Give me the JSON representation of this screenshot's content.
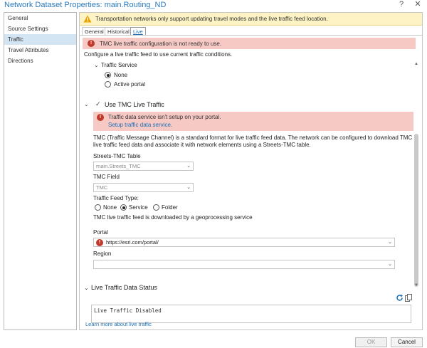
{
  "window": {
    "title": "Network Dataset Properties: main.Routing_ND",
    "help_glyph": "?",
    "close_glyph": "✕"
  },
  "sidebar": {
    "items": [
      {
        "label": "General"
      },
      {
        "label": "Source Settings"
      },
      {
        "label": "Traffic"
      },
      {
        "label": "Travel Attributes"
      },
      {
        "label": "Directions"
      }
    ]
  },
  "warning": {
    "text": "Transportation networks only support updating travel modes and the live traffic feed location."
  },
  "tabs": [
    {
      "label": "General"
    },
    {
      "label": "Historical"
    },
    {
      "label": "Live"
    }
  ],
  "error_banner": {
    "text": "TMC live traffic configuration is not ready to use."
  },
  "live": {
    "intro": "Configure a live traffic feed to use current traffic conditions.",
    "traffic_service": {
      "label": "Traffic Service",
      "options": [
        "None",
        "Active portal"
      ],
      "selected": "None"
    },
    "use_tmc": {
      "label": "Use TMC Live Traffic",
      "checked": true,
      "error_text": "Traffic data service isn't setup on your portal.",
      "error_link": "Setup traffic data service.",
      "description": "TMC (Traffic Message Channel) is a standard format for live traffic feed data. The network can be configured to download TMC live traffic feed data and associate it with network elements using a Streets-TMC table.",
      "streets_tmc_label": "Streets-TMC Table",
      "streets_tmc_value": "main.Streets_TMC",
      "tmc_field_label": "TMC Field",
      "tmc_field_value": "TMC",
      "feed_type_label": "Traffic Feed Type:",
      "feed_type_options": [
        "None",
        "Service",
        "Folder"
      ],
      "feed_type_selected": "Service",
      "gp_note": "TMC live traffic feed is downloaded by a geoprocessing service",
      "portal_label": "Portal",
      "portal_value": "https://esri.com/portal/",
      "region_label": "Region",
      "region_value": ""
    },
    "status": {
      "label": "Live Traffic Data Status",
      "text": "Live Traffic Disabled"
    },
    "learn_more": "Learn more about live traffic"
  },
  "footer": {
    "ok": "OK",
    "cancel": "Cancel"
  }
}
